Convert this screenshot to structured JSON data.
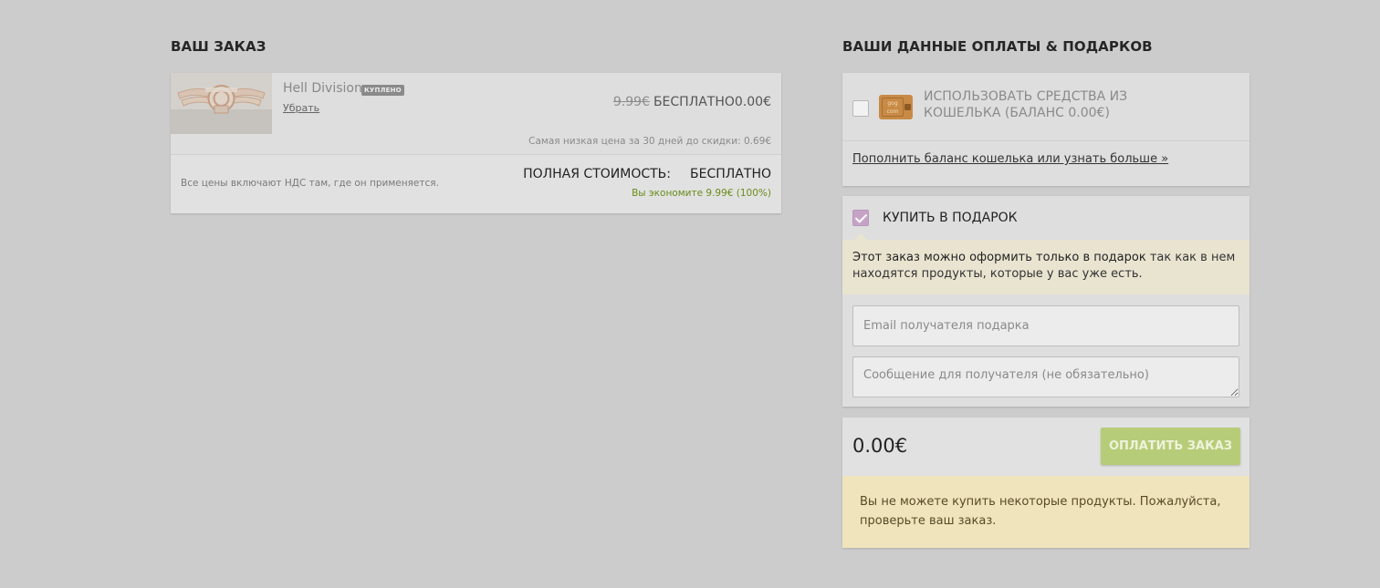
{
  "order": {
    "section_title": "ВАШ ЗАКАЗ",
    "item": {
      "title": "Hell Division",
      "badge": "КУПЛЕНО",
      "remove_label": "Убрать",
      "old_price": "9.99€",
      "free_label": "БЕСПЛАТНО",
      "price": "0.00€",
      "lowest_price_note": "Самая низкая цена за 30 дней до скидки: 0.69€"
    },
    "vat_note": "Все цены включают НДС там, где он применяется.",
    "total_label": "ПОЛНАЯ СТОИМОСТЬ:",
    "total_value": "БЕСПЛАТНО",
    "savings": "Вы экономите 9.99€ (100%)"
  },
  "payment": {
    "section_title": "ВАШИ ДАННЫЕ ОПЛАТЫ & ПОДАРКОВ",
    "wallet": {
      "checked": false,
      "icon": "gog-wallet-icon",
      "icon_text": "gog com",
      "label": "ИСПОЛЬЗОВАТЬ СРЕДСТВА ИЗ КОШЕЛЬКА (БАЛАНС 0.00€)",
      "link": "Пополнить баланс кошелька или узнать больше »"
    },
    "gift": {
      "checked": true,
      "label": "КУПИТЬ В ПОДАРОК",
      "notice_strong": "Этот заказ можно оформить только в подарок",
      "notice_rest": " так как в нем находятся продукты, которые у вас уже есть.",
      "email_placeholder": "Email получателя подарка",
      "message_placeholder": "Сообщение для получателя (не обязательно)"
    },
    "amount": "0.00€",
    "pay_button": "ОПЛАТИТЬ ЗАКАЗ",
    "warning": "Вы не можете купить некоторые продукты. Пожалуйста, проверьте ваш заказ."
  },
  "colors": {
    "background": "#cccccc",
    "card": "#e1e1e1",
    "savings_green": "#6a8d1a",
    "pay_button": "#b7cc78",
    "gift_checkbox": "#c6a3c6",
    "notice_bg": "#e9e4d0",
    "warning_bg": "#efe4bc"
  }
}
